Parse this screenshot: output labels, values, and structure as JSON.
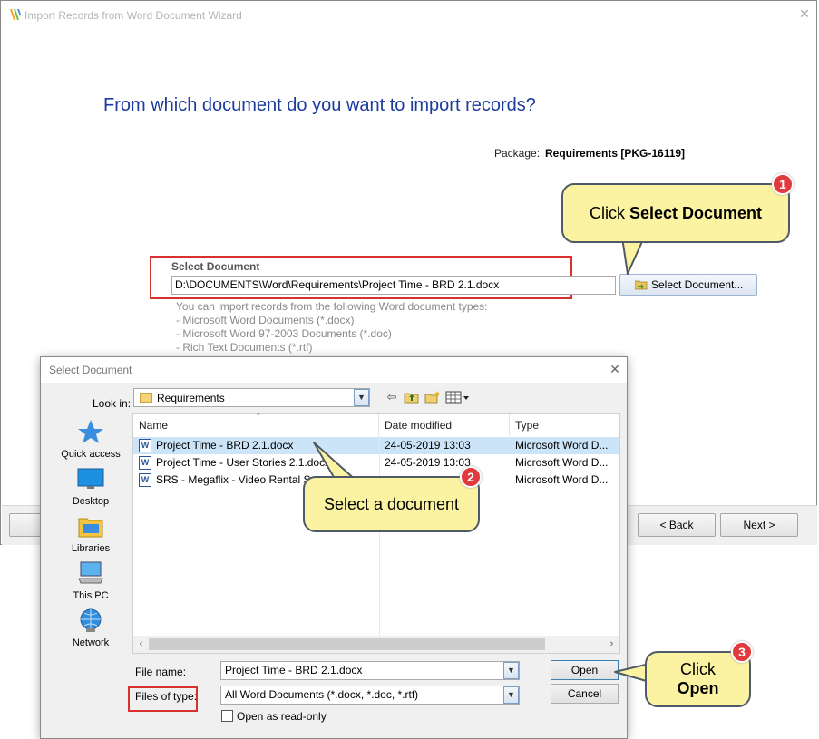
{
  "wizard": {
    "title": "Import Records from Word Document Wizard",
    "question": "From which document do you want to import records?",
    "package_label": "Package:",
    "package_value": "Requirements [PKG-16119]",
    "select_document_label": "Select Document",
    "select_document_path": "D:\\DOCUMENTS\\Word\\Requirements\\Project Time - BRD 2.1.docx",
    "select_document_button": "Select Document...",
    "help_lines": [
      "You can import records from the following Word document types:",
      "- Microsoft Word Documents (*.docx)",
      "- Microsoft Word 97-2003 Documents (*.doc)",
      "- Rich Text Documents (*.rtf)"
    ],
    "back_button": "< Back",
    "next_button": "Next >"
  },
  "dialog": {
    "title": "Select Document",
    "look_in_label": "Look in:",
    "look_in_value": "Requirements",
    "places": [
      "Quick access",
      "Desktop",
      "Libraries",
      "This PC",
      "Network"
    ],
    "columns": [
      "Name",
      "Date modified",
      "Type"
    ],
    "files": [
      {
        "name": "Project Time - BRD 2.1.docx",
        "date": "24-05-2019 13:03",
        "type": "Microsoft Word D..."
      },
      {
        "name": "Project Time - User Stories 2.1.docx",
        "date": "24-05-2019 13:03",
        "type": "Microsoft Word D..."
      },
      {
        "name": "SRS - Megaflix - Video Rental Syst...",
        "date": "",
        "type": "Microsoft Word D..."
      }
    ],
    "file_name_label": "File name:",
    "file_name_value": "Project Time - BRD 2.1.docx",
    "files_of_type_label": "Files of type:",
    "files_of_type_value": "All Word Documents (*.docx, *.doc, *.rtf)",
    "open_readonly_label": "Open as read-only",
    "open_button": "Open",
    "cancel_button": "Cancel"
  },
  "callouts": {
    "c1_prefix": "Click",
    "c1_bold": "Select Document",
    "c1_number": "1",
    "c2_text": "Select a document",
    "c2_number": "2",
    "c3_line1": "Click",
    "c3_line2": "Open",
    "c3_number": "3"
  },
  "colors": {
    "question": "#1c3b9e",
    "callout_fill": "#fbf3a1",
    "badge": "#e0393e",
    "highlight_box": "#d93030",
    "selected_row": "#cce4f7"
  }
}
